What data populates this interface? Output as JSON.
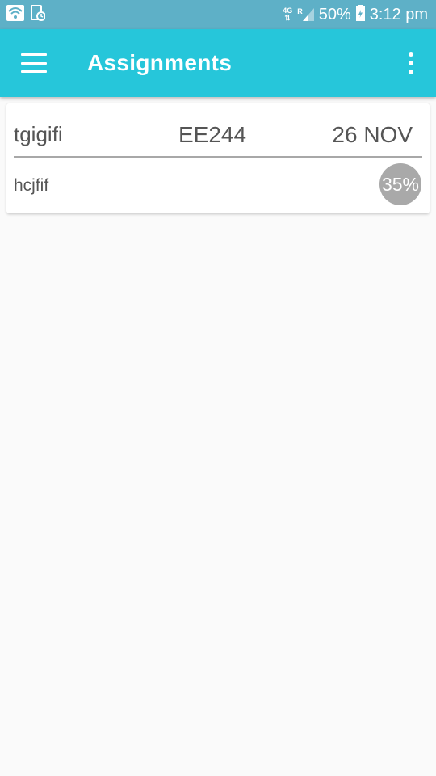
{
  "status_bar": {
    "network_type": "4G",
    "roaming": "R",
    "battery_percent": "50%",
    "time": "3:12 pm",
    "icons": [
      "wifi-icon",
      "screenshot-icon",
      "data-arrows-icon",
      "signal-icon",
      "battery-icon"
    ]
  },
  "app_bar": {
    "title": "Assignments",
    "color": "#26c6da"
  },
  "assignments": [
    {
      "title": "tgigifi",
      "code": "EE244",
      "date": "26 NOV",
      "description": "hcjfif",
      "progress_label": "35%",
      "progress": 0.35
    }
  ]
}
